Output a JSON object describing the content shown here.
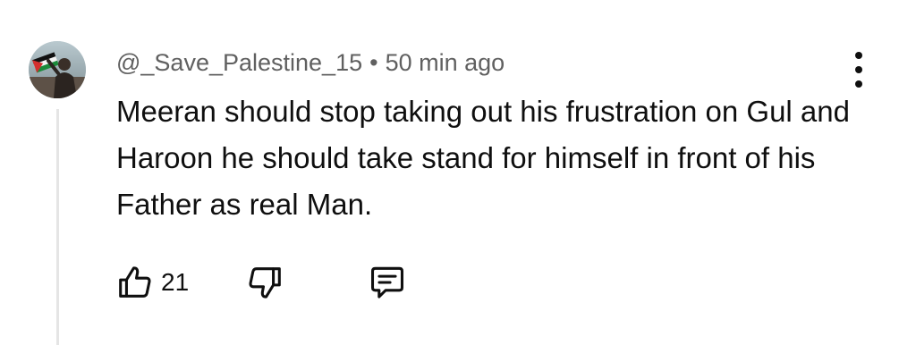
{
  "comment": {
    "author": "@_Save_Palestine_15",
    "separator": "•",
    "time": "50 min ago",
    "text": "Meeran should stop taking out his frustration on Gul and Haroon he should take stand for himself in front of his Father as real Man.",
    "like_count": "21"
  },
  "icons": {
    "like": "thumbs-up-icon",
    "dislike": "thumbs-down-icon",
    "reply": "reply-comment-icon",
    "menu": "more-vertical-icon"
  },
  "colors": {
    "meta_text": "#606060",
    "body_text": "#0f0f0f",
    "thread_line": "#e5e5e5"
  }
}
